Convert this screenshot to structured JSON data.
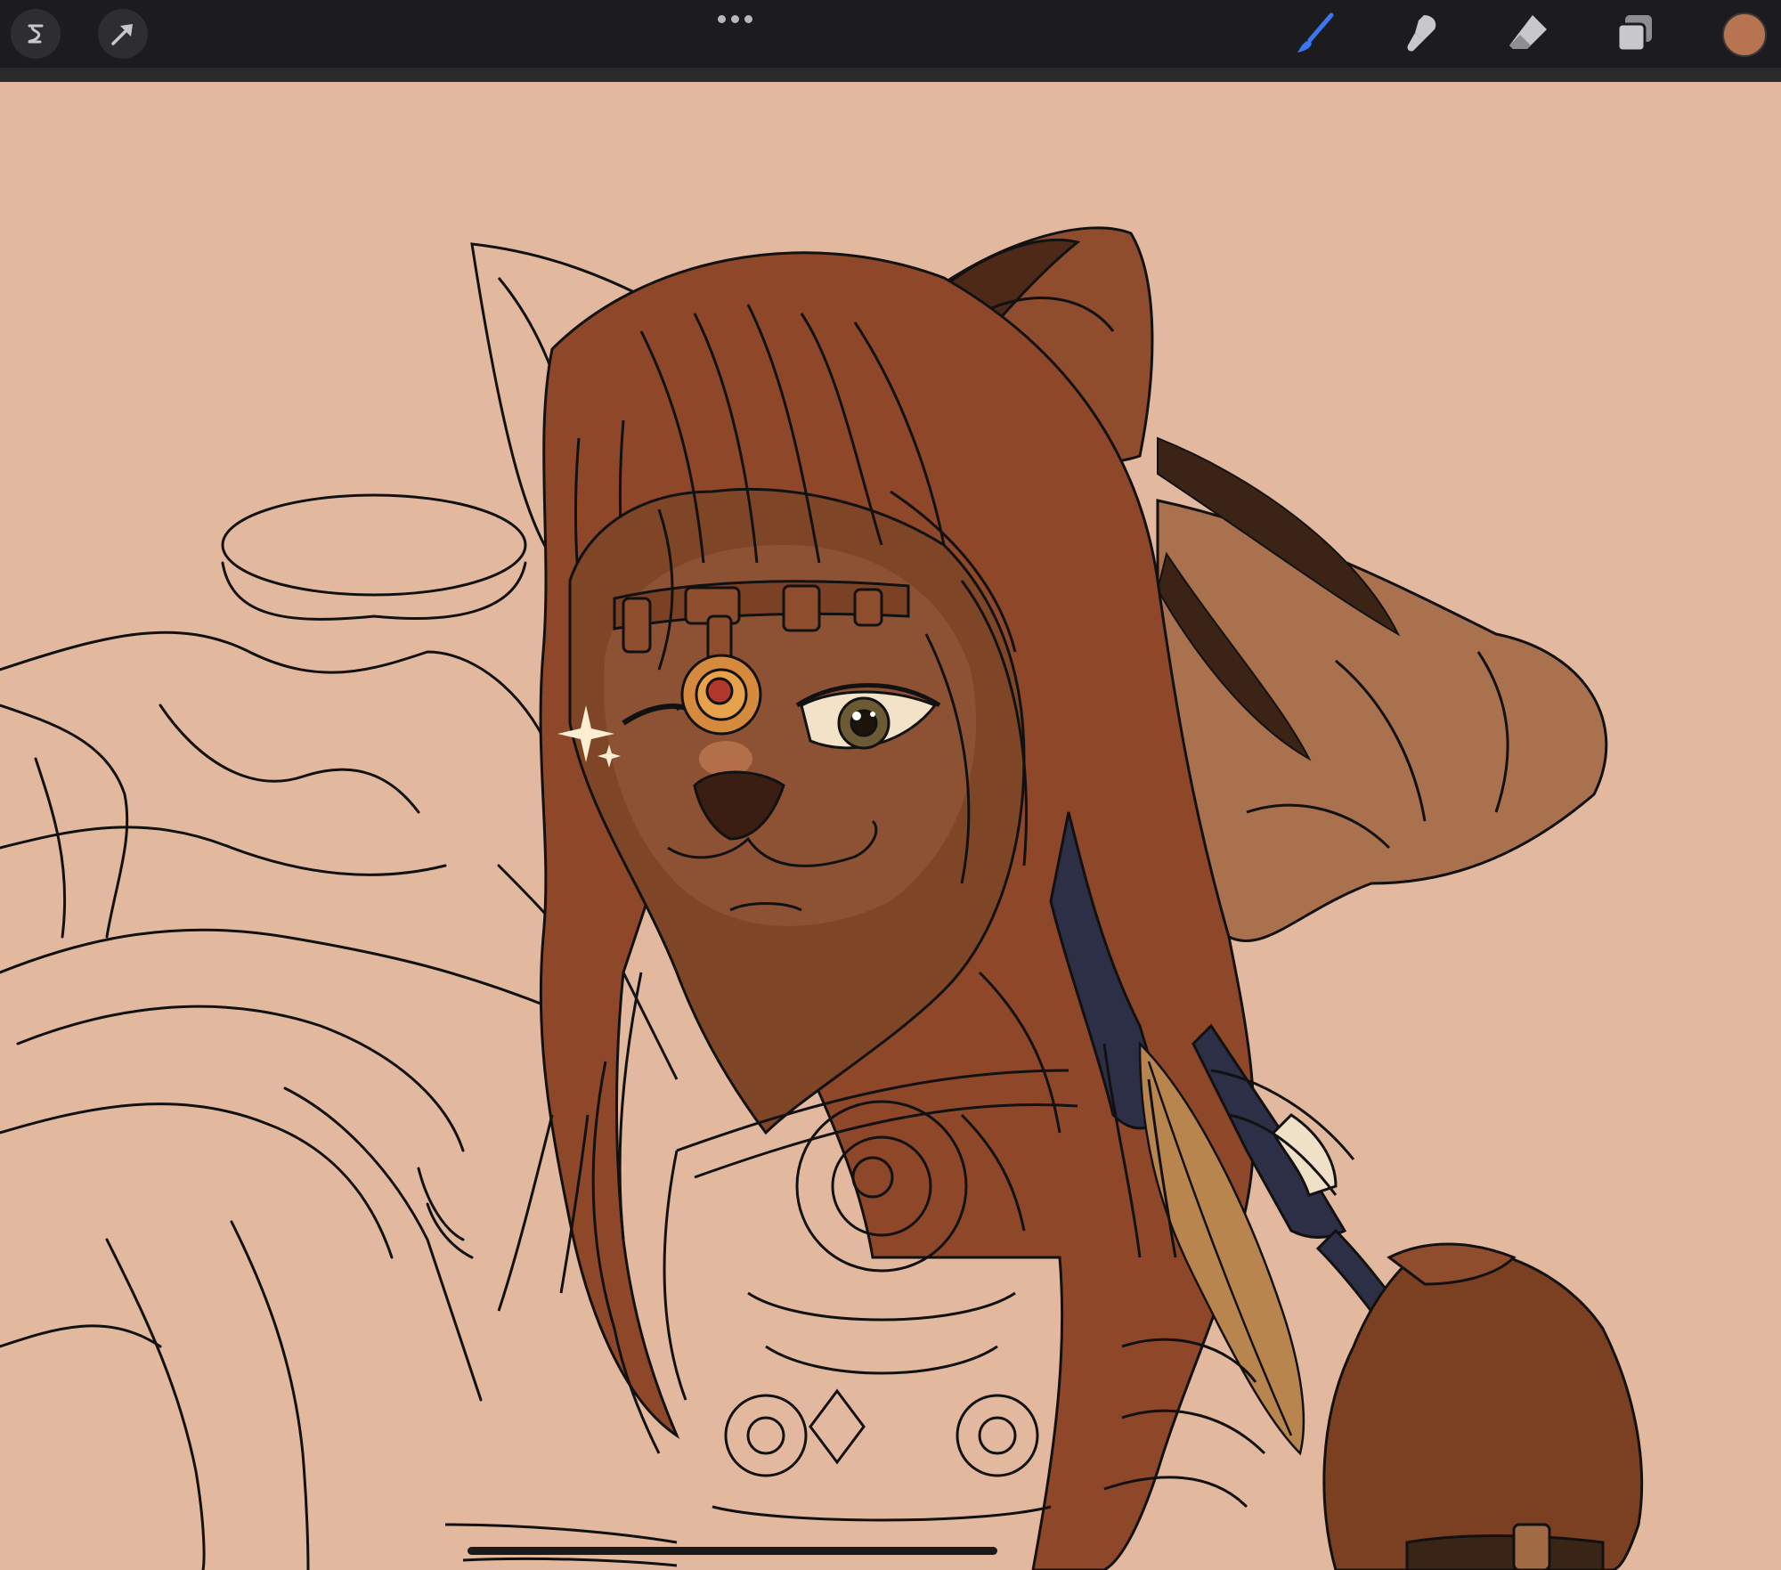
{
  "toolbar": {
    "left_tools": [
      {
        "name": "modify-tool",
        "icon": "wrench-icon"
      },
      {
        "name": "selection-tool",
        "icon": "arrow-cursor-icon"
      }
    ],
    "center_menu_icon": "more-options-icon",
    "right_tools": [
      {
        "name": "brush",
        "icon": "brush-icon",
        "active": true
      },
      {
        "name": "smudge",
        "icon": "smudge-icon"
      },
      {
        "name": "eraser",
        "icon": "eraser-icon"
      },
      {
        "name": "layers",
        "icon": "layers-icon"
      }
    ],
    "current_color": "#b87350",
    "active_color": "#3a78f2"
  },
  "canvas": {
    "background_color": "#e2b99e",
    "subject": "lion-character-artwork"
  }
}
